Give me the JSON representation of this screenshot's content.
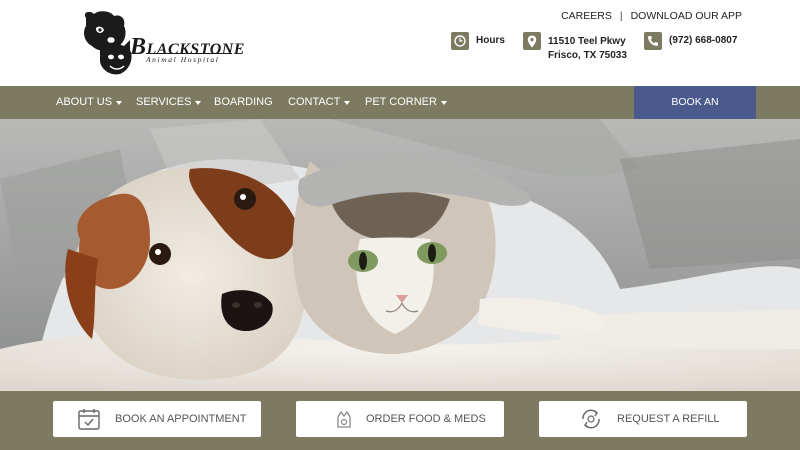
{
  "brand": {
    "name_initial": "B",
    "name_rest": "LACKSTONE",
    "subtitle": "Animal Hospital"
  },
  "toplinks": {
    "careers": "CAREERS",
    "separator": "|",
    "app": "DOWNLOAD OUR APP"
  },
  "info": {
    "hours": "Hours",
    "address_line1": "11510 Teel Pkwy",
    "address_line2": "Frisco, TX 75033",
    "phone": "(972) 668-0807"
  },
  "nav": {
    "items": [
      {
        "label": "ABOUT US",
        "dropdown": true
      },
      {
        "label": "SERVICES",
        "dropdown": true
      },
      {
        "label": "BOARDING",
        "dropdown": false
      },
      {
        "label": "CONTACT",
        "dropdown": true
      },
      {
        "label": "PET CORNER",
        "dropdown": true
      }
    ],
    "book": "BOOK AN APPOINTMENT"
  },
  "hero": {
    "image": "dog-and-cat-under-blanket"
  },
  "cta": [
    {
      "label": "BOOK AN APPOINTMENT",
      "icon": "calendar-check-icon"
    },
    {
      "label": "ORDER FOOD & MEDS",
      "icon": "pet-food-icon"
    },
    {
      "label": "REQUEST A REFILL",
      "icon": "refill-pill-icon"
    }
  ],
  "colors": {
    "olive": "#7c7a60",
    "navy": "#4a5a8c",
    "white": "#ffffff"
  }
}
